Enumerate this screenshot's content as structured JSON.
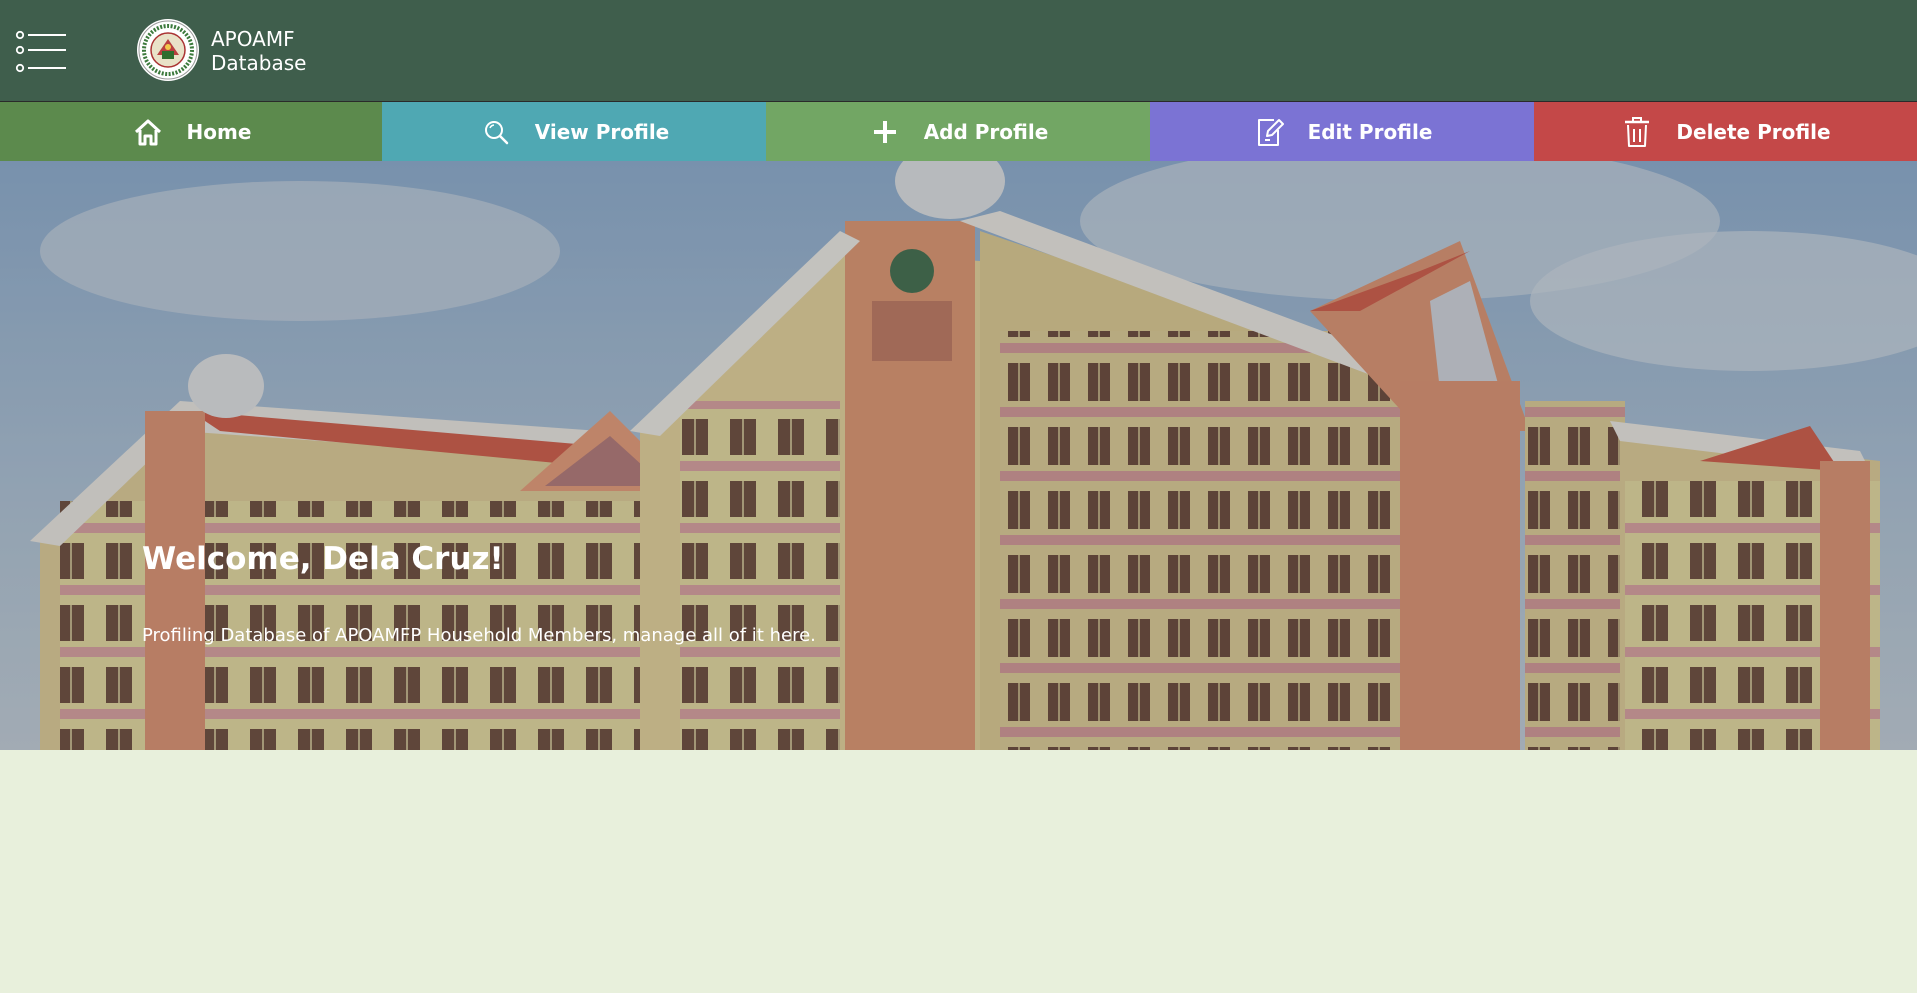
{
  "header": {
    "brand_line1": "APOAMF",
    "brand_line2": "Database",
    "menu_icon": "menu-list-icon",
    "logo_icon": "apoamf-seal-logo"
  },
  "nav": {
    "items": [
      {
        "label": "Home",
        "icon": "home-icon",
        "color": "#5c8a4d"
      },
      {
        "label": "View Profile",
        "icon": "search-icon",
        "color": "#4fa8b3"
      },
      {
        "label": "Add Profile",
        "icon": "plus-icon",
        "color": "#72a664"
      },
      {
        "label": "Edit Profile",
        "icon": "edit-icon",
        "color": "#7b73d4"
      },
      {
        "label": "Delete Profile",
        "icon": "trash-icon",
        "color": "#c44848"
      }
    ]
  },
  "hero": {
    "title": "Welcome, Dela Cruz!",
    "subtitle": "Profiling Database of APOAMFP Household Members, manage all of it here."
  },
  "colors": {
    "header_bg": "#3f5e4c",
    "page_bg": "#e8f0dc"
  }
}
